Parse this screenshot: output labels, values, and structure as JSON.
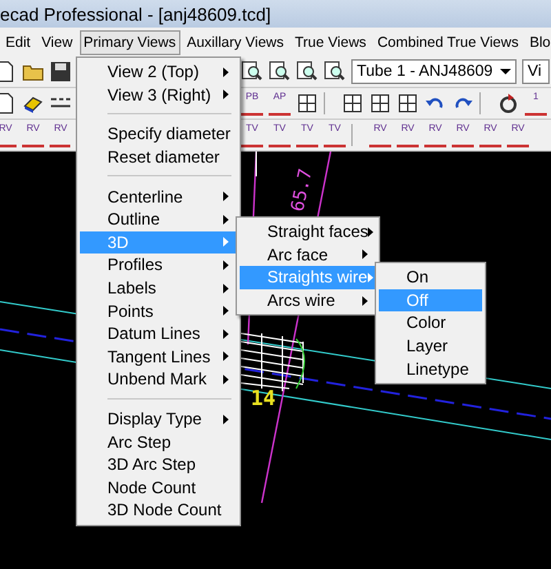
{
  "window": {
    "title": "ecad Professional  - [anj48609.tcd]"
  },
  "menu_bar": [
    {
      "label": "Edit",
      "selected": false
    },
    {
      "label": "View",
      "selected": false
    },
    {
      "label": "Primary Views",
      "selected": true
    },
    {
      "label": "Auxillary Views",
      "selected": false
    },
    {
      "label": "True Views",
      "selected": false
    },
    {
      "label": "Combined True Views",
      "selected": false
    },
    {
      "label": "Blo",
      "selected": false
    }
  ],
  "toolbars": [
    {
      "left": [
        {
          "kind": "page"
        },
        {
          "kind": "folder"
        },
        {
          "kind": "save"
        }
      ],
      "right": [
        {
          "kind": "zoom"
        },
        {
          "kind": "zoom"
        },
        {
          "kind": "zoom"
        },
        {
          "kind": "zoom"
        }
      ],
      "combo": {
        "value": "Tube 1 - ANJ48609"
      },
      "extra_field": {
        "value": "Vi"
      }
    },
    {
      "left": [
        {
          "kind": "page"
        },
        {
          "kind": "eraser"
        },
        {
          "kind": "dashes"
        }
      ],
      "right": [
        {
          "kind": "label",
          "text": "PB"
        },
        {
          "kind": "label",
          "text": "AP"
        },
        {
          "kind": "grid"
        },
        {
          "kind": "gap"
        },
        {
          "kind": "grid"
        },
        {
          "kind": "grid"
        },
        {
          "kind": "grid"
        },
        {
          "kind": "undo"
        },
        {
          "kind": "redo"
        },
        {
          "kind": "gap"
        },
        {
          "kind": "refresh"
        },
        {
          "kind": "label",
          "text": "1"
        }
      ]
    },
    {
      "left": [
        {
          "kind": "label",
          "text": "RV"
        },
        {
          "kind": "label",
          "text": "RV"
        },
        {
          "kind": "label",
          "text": "RV"
        }
      ],
      "right": [
        {
          "kind": "label",
          "text": "TV"
        },
        {
          "kind": "label",
          "text": "TV"
        },
        {
          "kind": "label",
          "text": "TV"
        },
        {
          "kind": "label",
          "text": "TV"
        },
        {
          "kind": "gap"
        },
        {
          "kind": "label",
          "text": "RV"
        },
        {
          "kind": "label",
          "text": "RV"
        },
        {
          "kind": "label",
          "text": "RV"
        },
        {
          "kind": "label",
          "text": "RV"
        },
        {
          "kind": "label",
          "text": "RV"
        },
        {
          "kind": "label",
          "text": "RV"
        }
      ]
    }
  ],
  "canvas": {
    "dimension": "65.7",
    "node_label": "14"
  },
  "menus": [
    {
      "items": [
        {
          "kind": "item",
          "label": "View 2 (Top)",
          "submenu": true,
          "selected": false
        },
        {
          "kind": "item",
          "label": "View 3 (Right)",
          "submenu": true,
          "selected": false
        },
        {
          "kind": "separator"
        },
        {
          "kind": "item",
          "label": "Specify diameter",
          "submenu": false,
          "selected": false
        },
        {
          "kind": "item",
          "label": "Reset diameter",
          "submenu": false,
          "selected": false
        },
        {
          "kind": "separator"
        },
        {
          "kind": "item",
          "label": "Centerline",
          "submenu": true,
          "selected": false
        },
        {
          "kind": "item",
          "label": "Outline",
          "submenu": true,
          "selected": false
        },
        {
          "kind": "item",
          "label": "3D",
          "submenu": true,
          "selected": true
        },
        {
          "kind": "item",
          "label": "Profiles",
          "submenu": true,
          "selected": false
        },
        {
          "kind": "item",
          "label": "Labels",
          "submenu": true,
          "selected": false
        },
        {
          "kind": "item",
          "label": "Points",
          "submenu": true,
          "selected": false
        },
        {
          "kind": "item",
          "label": "Datum Lines",
          "submenu": true,
          "selected": false
        },
        {
          "kind": "item",
          "label": "Tangent Lines",
          "submenu": true,
          "selected": false
        },
        {
          "kind": "item",
          "label": "Unbend Mark",
          "submenu": true,
          "selected": false
        },
        {
          "kind": "separator"
        },
        {
          "kind": "item",
          "label": "Display Type",
          "submenu": true,
          "selected": false
        },
        {
          "kind": "item",
          "label": "Arc Step",
          "submenu": false,
          "selected": false
        },
        {
          "kind": "item",
          "label": "3D Arc Step",
          "submenu": false,
          "selected": false
        },
        {
          "kind": "item",
          "label": "Node Count",
          "submenu": false,
          "selected": false
        },
        {
          "kind": "item",
          "label": "3D Node Count",
          "submenu": false,
          "selected": false
        }
      ]
    },
    {
      "items": [
        {
          "kind": "item",
          "label": "Straight faces",
          "submenu": true,
          "selected": false
        },
        {
          "kind": "item",
          "label": "Arc face",
          "submenu": true,
          "selected": false
        },
        {
          "kind": "item",
          "label": "Straights wire",
          "submenu": true,
          "selected": true
        },
        {
          "kind": "item",
          "label": "Arcs wire",
          "submenu": true,
          "selected": false
        }
      ]
    },
    {
      "items": [
        {
          "kind": "item",
          "label": "On",
          "submenu": false,
          "selected": false
        },
        {
          "kind": "item",
          "label": "Off",
          "submenu": false,
          "selected": true
        },
        {
          "kind": "item",
          "label": "Color",
          "submenu": false,
          "selected": false
        },
        {
          "kind": "item",
          "label": "Layer",
          "submenu": false,
          "selected": false
        },
        {
          "kind": "item",
          "label": "Linetype",
          "submenu": false,
          "selected": false
        }
      ]
    }
  ]
}
